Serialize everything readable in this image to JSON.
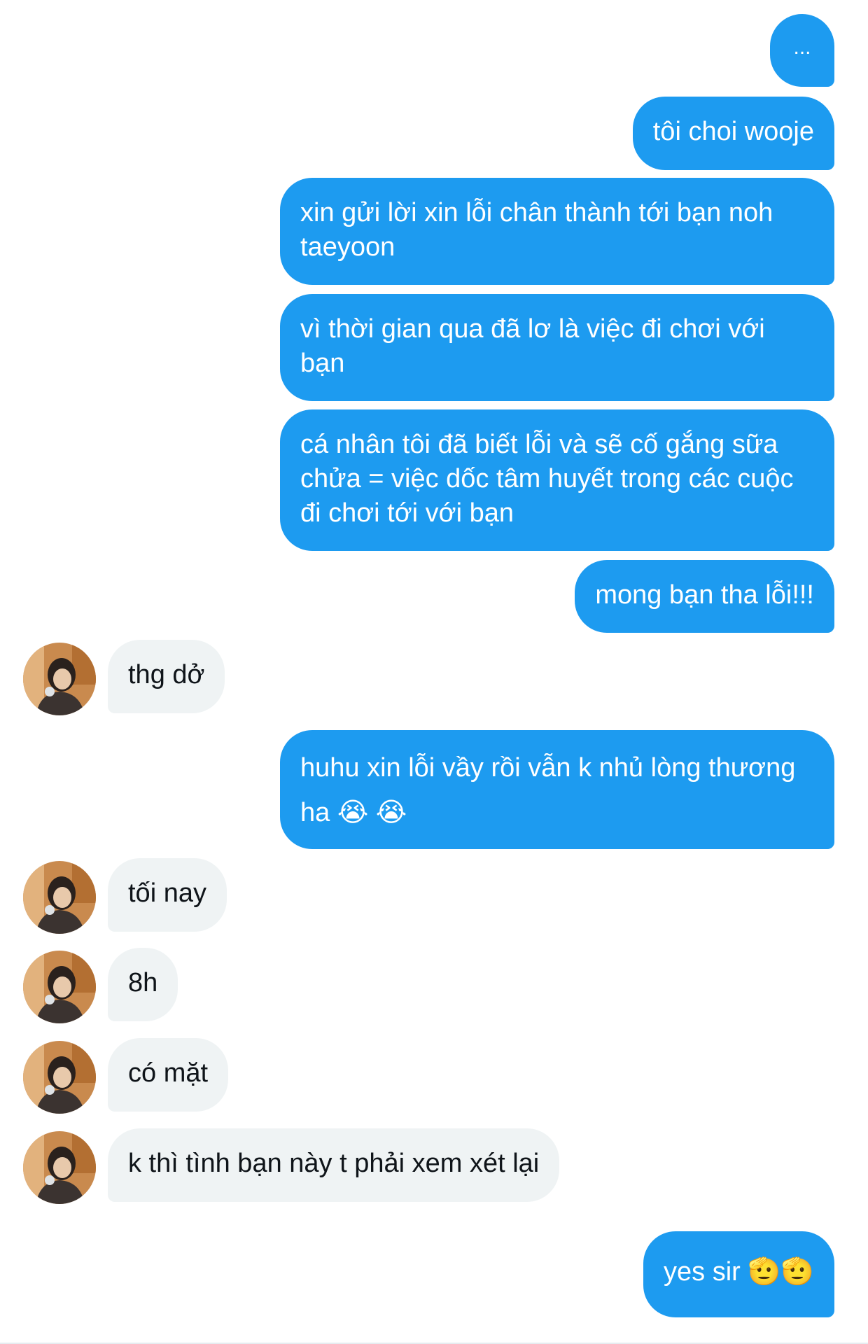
{
  "conversation": {
    "messages": [
      {
        "side": "out",
        "text": "..."
      },
      {
        "side": "out",
        "text": "tôi choi wooje"
      },
      {
        "side": "out",
        "text": "xin gửi lời xin lỗi chân thành tới bạn noh taeyoon"
      },
      {
        "side": "out",
        "text": "vì thời gian qua đã lơ là việc đi chơi với bạn"
      },
      {
        "side": "out",
        "text": "cá nhân tôi đã biết lỗi và sẽ cố gắng sữa chửa = việc dốc tâm huyết trong các cuộc đi chơi tới với bạn"
      },
      {
        "side": "out",
        "text": "mong bạn tha lỗi!!!"
      },
      {
        "side": "in",
        "text": "thg dở"
      },
      {
        "side": "out",
        "text": "huhu xin lỗi vầy rồi vẫn k nhủ lòng thương ha 😭 😭"
      },
      {
        "side": "in",
        "text": "tối nay"
      },
      {
        "side": "in",
        "text": "8h"
      },
      {
        "side": "in",
        "text": "có mặt"
      },
      {
        "side": "in",
        "text": "k thì tình bạn này t phải xem xét lại"
      },
      {
        "side": "out",
        "text": "yes sir 🫡🫡"
      }
    ]
  },
  "colors": {
    "outgoing_bubble": "#1d9bf0",
    "incoming_bubble": "#eff3f4",
    "outgoing_text": "#ffffff",
    "incoming_text": "#0f1419"
  },
  "icons": {
    "avatar": "contact-avatar-photo"
  }
}
